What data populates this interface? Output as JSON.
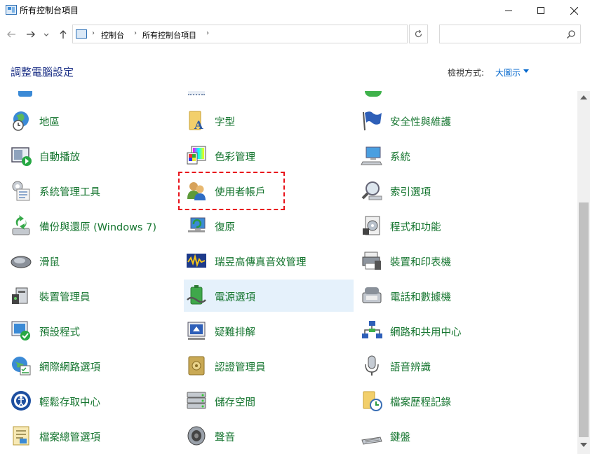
{
  "window": {
    "title": "所有控制台項目",
    "close_icon": "close-icon",
    "min_icon": "minimize-icon",
    "max_icon": "maximize-icon"
  },
  "address_bar": {
    "breadcrumbs": [
      "控制台",
      "所有控制台項目"
    ],
    "separator": "›",
    "refresh_icon": "refresh-icon",
    "dropdown_icon": "chevron-down-icon"
  },
  "search": {
    "placeholder": "",
    "value": "",
    "icon": "search-icon"
  },
  "header": {
    "title": "調整電腦設定",
    "view_by_label": "檢視方式:",
    "view_by_value": "大圖示"
  },
  "items": [
    {
      "label": "地區",
      "icon": "region-globe-clock-icon"
    },
    {
      "label": "字型",
      "icon": "fonts-folder-icon"
    },
    {
      "label": "安全性與維護",
      "icon": "security-flag-icon"
    },
    {
      "label": "自動播放",
      "icon": "autoplay-icon"
    },
    {
      "label": "色彩管理",
      "icon": "color-management-icon"
    },
    {
      "label": "系統",
      "icon": "system-computer-icon"
    },
    {
      "label": "系統管理工具",
      "icon": "admin-tools-icon"
    },
    {
      "label": "使用者帳戶",
      "icon": "user-accounts-icon"
    },
    {
      "label": "索引選項",
      "icon": "indexing-magnifier-icon"
    },
    {
      "label": "備份與還原 (Windows 7)",
      "icon": "backup-restore-icon"
    },
    {
      "label": "復原",
      "icon": "recovery-icon"
    },
    {
      "label": "程式和功能",
      "icon": "programs-features-icon"
    },
    {
      "label": "滑鼠",
      "icon": "mouse-icon"
    },
    {
      "label": "瑞昱高傳真音效管理",
      "icon": "realtek-audio-icon"
    },
    {
      "label": "裝置和印表機",
      "icon": "devices-printers-icon"
    },
    {
      "label": "裝置管理員",
      "icon": "device-manager-icon"
    },
    {
      "label": "電源選項",
      "icon": "power-options-icon"
    },
    {
      "label": "電話和數據機",
      "icon": "phone-modem-icon"
    },
    {
      "label": "預設程式",
      "icon": "default-programs-icon"
    },
    {
      "label": "疑難排解",
      "icon": "troubleshooting-icon"
    },
    {
      "label": "網路和共用中心",
      "icon": "network-sharing-icon"
    },
    {
      "label": "網際網路選項",
      "icon": "internet-options-icon"
    },
    {
      "label": "認證管理員",
      "icon": "credential-manager-icon"
    },
    {
      "label": "語音辨識",
      "icon": "speech-recognition-icon"
    },
    {
      "label": "輕鬆存取中心",
      "icon": "ease-of-access-icon"
    },
    {
      "label": "儲存空間",
      "icon": "storage-spaces-icon"
    },
    {
      "label": "檔案歷程記錄",
      "icon": "file-history-icon"
    },
    {
      "label": "檔案總管選項",
      "icon": "file-explorer-options-icon"
    },
    {
      "label": "聲音",
      "icon": "sound-speaker-icon"
    },
    {
      "label": "鍵盤",
      "icon": "keyboard-icon"
    }
  ],
  "hover_item": "電源選項",
  "annotated_item": "使用者帳戶",
  "colors": {
    "item_text": "#15752f",
    "title_text": "#1e3287",
    "link_text": "#0066cc",
    "hover_bg": "#e5f1fb",
    "annotation_border": "#e8141c"
  }
}
